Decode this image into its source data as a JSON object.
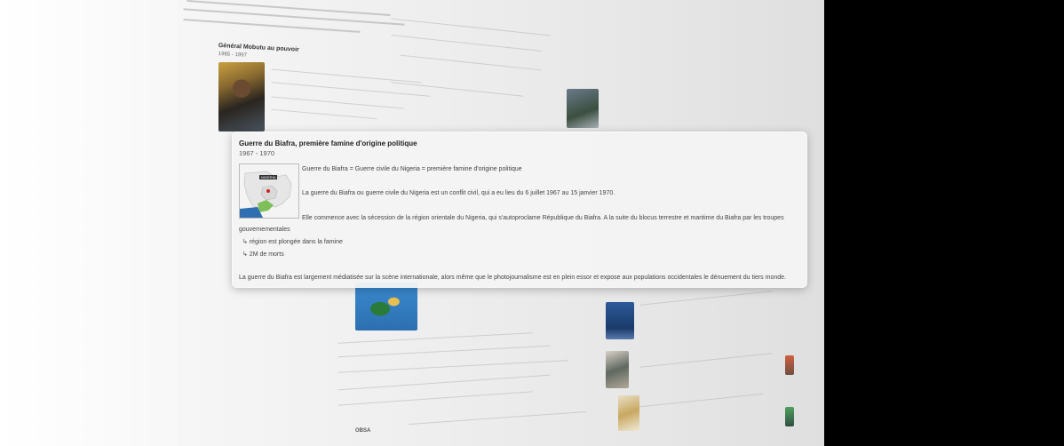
{
  "background": {
    "section_heading": "Général Mobutu au pouvoir",
    "section_dates": "1965 - 1997",
    "bottom_label": "OBSA",
    "colors": {
      "black_area": "#000000",
      "page_gray": "#ececec"
    }
  },
  "popup": {
    "title": "Guerre du Biafra, première famine d'origine politique",
    "dates": "1967 - 1970",
    "map_thumb": {
      "label": "NIGERIA",
      "icon": "map-icon"
    },
    "paragraph_1": "Guerre du Biafra = Guerre civile du Nigeria = première famine d'origine politique",
    "paragraph_2": "La guerre du Biafra ou guerre civile du Nigeria est un conflit civil, qui a eu lieu du 6 juillet 1967 au 15 janvier 1970.",
    "paragraph_3": "Elle commence avec la sécession de la région orientale du Nigeria, qui s'autoproclame République du Biafra. A la suite du blocus terrestre et maritime du Biafra par les troupes",
    "paragraph_3_cont": "gouvernementales",
    "bullets": [
      "↳ région est plongée dans la famine",
      "↳ 2M de morts"
    ],
    "paragraph_4": "La guerre du Biafra est largement médiatisée sur la scène internationale, alors même que le photojournalisme est en plein essor et expose aux populations occidentales le dénuement du tiers monde."
  }
}
